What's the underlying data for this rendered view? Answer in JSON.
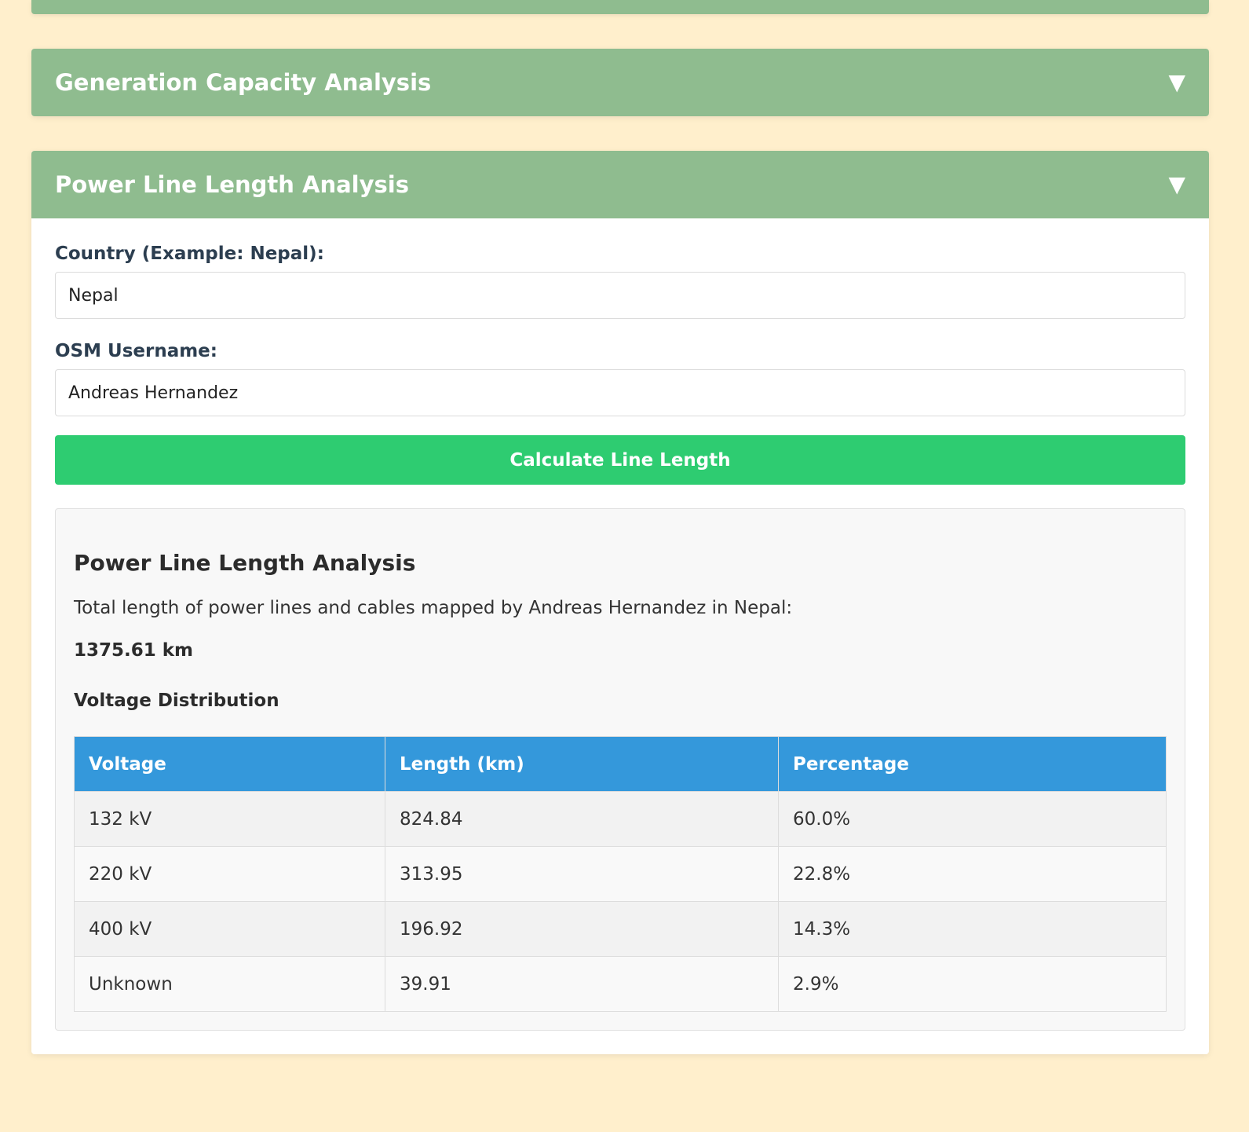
{
  "sections": {
    "generation": {
      "title": "Generation Capacity Analysis",
      "chevron": "▼"
    },
    "power_line": {
      "title": "Power Line Length Analysis",
      "chevron": "▼"
    }
  },
  "form": {
    "country_label": "Country (Example: Nepal):",
    "country_value": "Nepal",
    "username_label": "OSM Username:",
    "username_value": "Andreas Hernandez",
    "button_label": "Calculate Line Length"
  },
  "result": {
    "heading": "Power Line Length Analysis",
    "description": "Total length of power lines and cables mapped by Andreas Hernandez in Nepal:",
    "total": "1375.61 km",
    "distribution_heading": "Voltage Distribution",
    "table": {
      "headers": [
        "Voltage",
        "Length (km)",
        "Percentage"
      ],
      "rows": [
        [
          "132 kV",
          "824.84",
          "60.0%"
        ],
        [
          "220 kV",
          "313.95",
          "22.8%"
        ],
        [
          "400 kV",
          "196.92",
          "14.3%"
        ],
        [
          "Unknown",
          "39.91",
          "2.9%"
        ]
      ]
    }
  },
  "colors": {
    "background": "#ffefcc",
    "panel_header": "#8fbc8f",
    "button": "#2ecc71",
    "table_header": "#3498db"
  }
}
